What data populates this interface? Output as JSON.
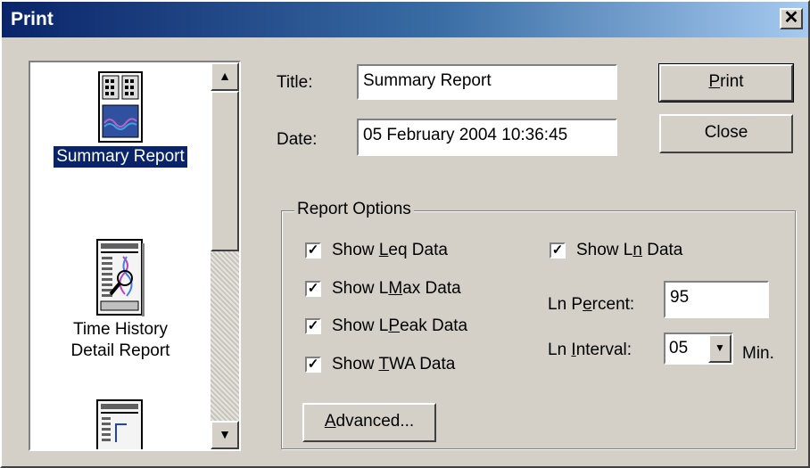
{
  "window": {
    "title": "Print",
    "close_glyph": "✕"
  },
  "report_list": {
    "items": [
      {
        "label": "Summary Report",
        "icon": "summary-report-icon",
        "selected": true
      },
      {
        "label_line1": "Time History",
        "label_line2": "Detail Report",
        "icon": "time-history-report-icon",
        "selected": false
      },
      {
        "icon": "chart-report-icon",
        "selected": false
      }
    ],
    "scroll_up_glyph": "▲",
    "scroll_down_glyph": "▼"
  },
  "form": {
    "title_label": "Title:",
    "title_value": "Summary Report",
    "date_label": "Date:",
    "date_value": "05 February 2004 10:36:45"
  },
  "buttons": {
    "print_pre": "",
    "print_access": "P",
    "print_post": "rint",
    "close_label": "Close"
  },
  "report_options": {
    "legend": "Report Options",
    "options": [
      {
        "pre": "Show ",
        "access": "L",
        "post": "eq Data",
        "checked": true
      },
      {
        "pre": "Show L",
        "access": "M",
        "post": "ax Data",
        "checked": true
      },
      {
        "pre": "Show L",
        "access": "P",
        "post": "eak Data",
        "checked": true
      },
      {
        "pre": "Show ",
        "access": "T",
        "post": "WA Data",
        "checked": true
      },
      {
        "pre": "Show L",
        "access": "n",
        "post": " Data",
        "checked": true
      }
    ],
    "ln_percent_label_pre": "Ln P",
    "ln_percent_label_access": "e",
    "ln_percent_label_post": "rcent:",
    "ln_percent_value": "95",
    "ln_interval_label_pre": "Ln ",
    "ln_interval_label_access": "I",
    "ln_interval_label_post": "nterval:",
    "ln_interval_value": "05",
    "ln_interval_unit": "Min.",
    "advanced_access": "A",
    "advanced_post": "dvanced...",
    "check_glyph": "✓",
    "dropdown_glyph": "▼"
  },
  "colors": {
    "title_bar": "#0a246a",
    "face": "#d4d0c8",
    "selection": "#0a246a"
  }
}
